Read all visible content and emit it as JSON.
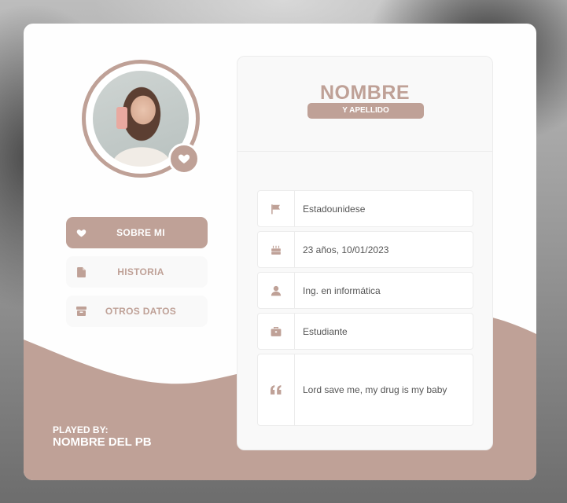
{
  "profile": {
    "name": "NOMBRE",
    "surname": "Y APELLIDO",
    "avatar_icon": "heart-icon"
  },
  "menu": {
    "items": [
      {
        "label": "SOBRE MI",
        "icon": "heart-icon",
        "active": true
      },
      {
        "label": "HISTORIA",
        "icon": "file-icon",
        "active": false
      },
      {
        "label": "OTROS DATOS",
        "icon": "box-icon",
        "active": false
      }
    ]
  },
  "played_by": {
    "label": "PLAYED BY:",
    "name": "NOMBRE DEL PB"
  },
  "fields": [
    {
      "icon": "flag-icon",
      "value": "Estadounidese"
    },
    {
      "icon": "cake-icon",
      "value": "23 años, 10/01/2023"
    },
    {
      "icon": "user-icon",
      "value": "Ing. en informática"
    },
    {
      "icon": "briefcase-icon",
      "value": "Estudiante"
    },
    {
      "icon": "quote-icon",
      "value": "Lord save me, my drug is my baby"
    }
  ],
  "colors": {
    "accent": "#bfa197",
    "card": "#fefefe",
    "panel": "#f9f9f9",
    "text": "#555555"
  }
}
